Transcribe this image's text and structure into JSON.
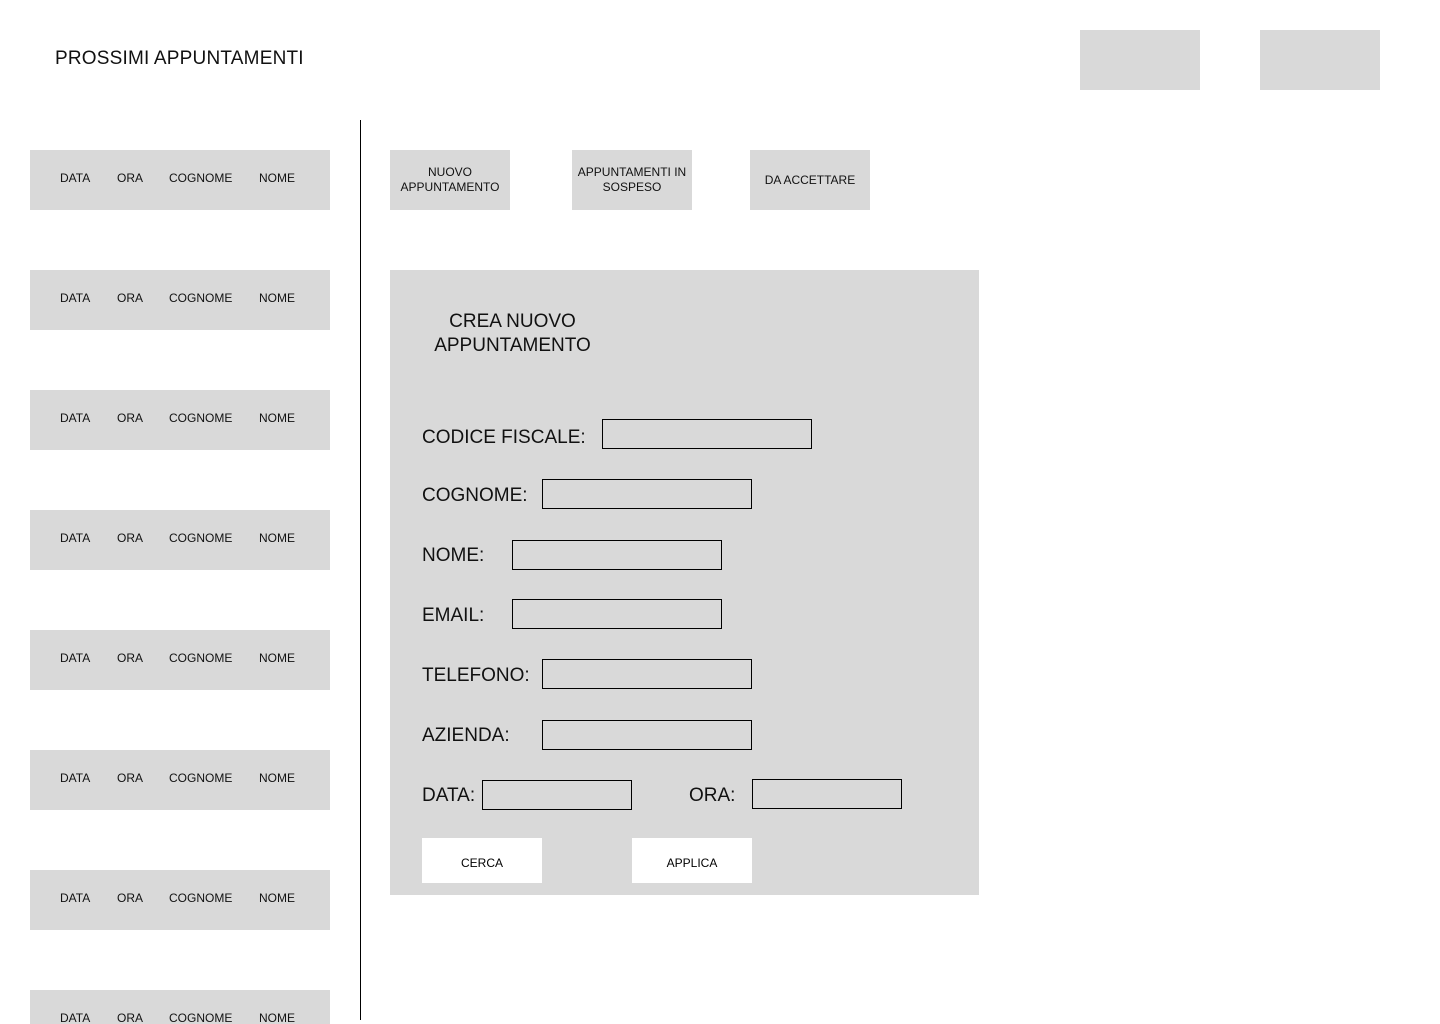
{
  "header": {
    "title": "PROSSIMI APPUNTAMENTI"
  },
  "appointments": {
    "columns": [
      "DATA",
      "ORA",
      "COGNOME",
      "NOME"
    ],
    "rows": [
      {
        "data": "DATA",
        "ora": "ORA",
        "cognome": "COGNOME",
        "nome": "NOME"
      },
      {
        "data": "DATA",
        "ora": "ORA",
        "cognome": "COGNOME",
        "nome": "NOME"
      },
      {
        "data": "DATA",
        "ora": "ORA",
        "cognome": "COGNOME",
        "nome": "NOME"
      },
      {
        "data": "DATA",
        "ora": "ORA",
        "cognome": "COGNOME",
        "nome": "NOME"
      },
      {
        "data": "DATA",
        "ora": "ORA",
        "cognome": "COGNOME",
        "nome": "NOME"
      },
      {
        "data": "DATA",
        "ora": "ORA",
        "cognome": "COGNOME",
        "nome": "NOME"
      },
      {
        "data": "DATA",
        "ora": "ORA",
        "cognome": "COGNOME",
        "nome": "NOME"
      },
      {
        "data": "DATA",
        "ora": "ORA",
        "cognome": "COGNOME",
        "nome": "NOME"
      }
    ]
  },
  "tabs": {
    "new_appointment": "NUOVO APPUNTAMENTO",
    "pending": "APPUNTAMENTI IN SOSPESO",
    "to_accept": "DA ACCETTARE"
  },
  "form": {
    "title": "CREA NUOVO APPUNTAMENTO",
    "fields": {
      "codice_fiscale": {
        "label": "CODICE FISCALE:",
        "value": ""
      },
      "cognome": {
        "label": "COGNOME:",
        "value": ""
      },
      "nome": {
        "label": "NOME:",
        "value": ""
      },
      "email": {
        "label": "EMAIL:",
        "value": ""
      },
      "telefono": {
        "label": "TELEFONO:",
        "value": ""
      },
      "azienda": {
        "label": "AZIENDA:",
        "value": ""
      },
      "data": {
        "label": "DATA:",
        "value": ""
      },
      "ora": {
        "label": "ORA:",
        "value": ""
      }
    },
    "search_label": "CERCA",
    "apply_label": "APPLICA"
  },
  "colors": {
    "panel_gray": "#d9d9d9",
    "border": "#000000",
    "background": "#ffffff"
  }
}
